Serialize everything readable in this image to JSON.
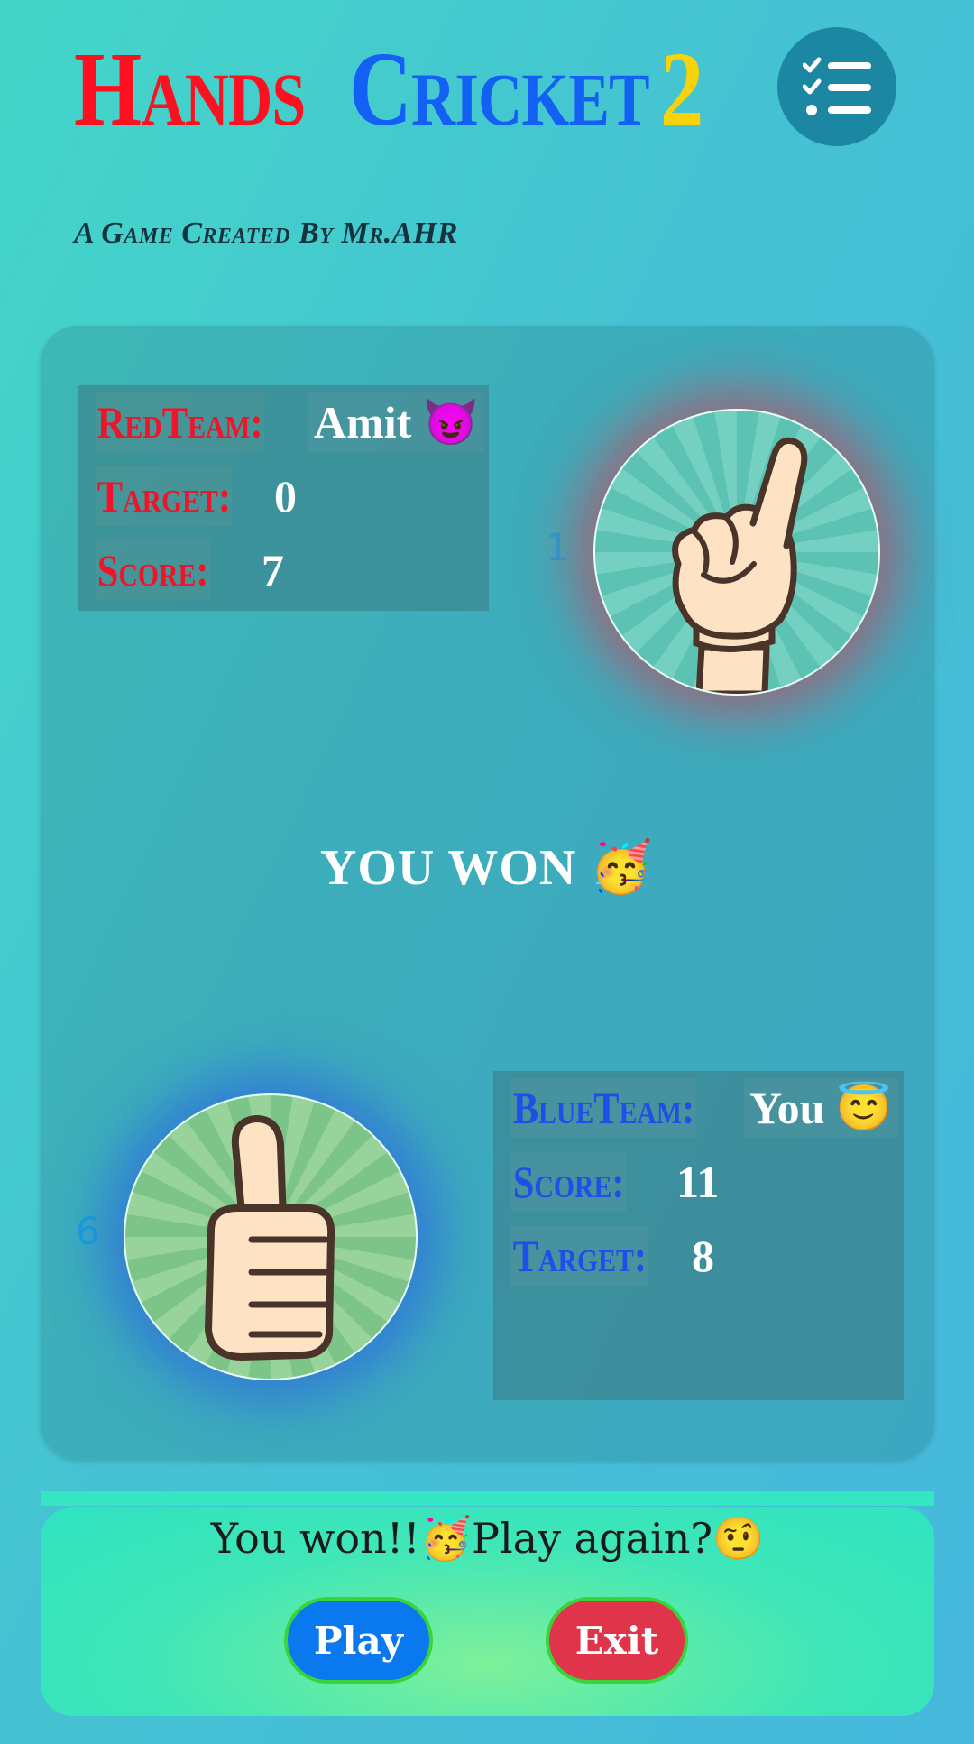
{
  "header": {
    "title_word1": "Hands",
    "title_word2": "Cricket",
    "title_word3": "2",
    "subtitle": "A Game Created By Mr.AHR",
    "menu_icon": "checklist-icon"
  },
  "red_team": {
    "label": "RedTeam:",
    "player": "Amit 😈",
    "target_label": "Target:",
    "target": "0",
    "score_label": "Score:",
    "score": "7",
    "hand_number": "1",
    "hand_icon": "one-finger-hand-icon"
  },
  "center": {
    "result": "YOU WON 🥳"
  },
  "blue_team": {
    "label": "BlueTeam:",
    "player": "You 😇",
    "score_label": "Score:",
    "score": "11",
    "target_label": "Target:",
    "target": "8",
    "hand_number": "6",
    "hand_icon": "thumbs-up-hand-icon"
  },
  "footer": {
    "message": "You won!!🥳Play again?🤨",
    "play_label": "Play",
    "exit_label": "Exit"
  },
  "colors": {
    "red": "#f0142a",
    "blue": "#1e4fe8",
    "yellow": "#f7d30a",
    "play": "#0a78ee",
    "exit": "#e0344a"
  }
}
